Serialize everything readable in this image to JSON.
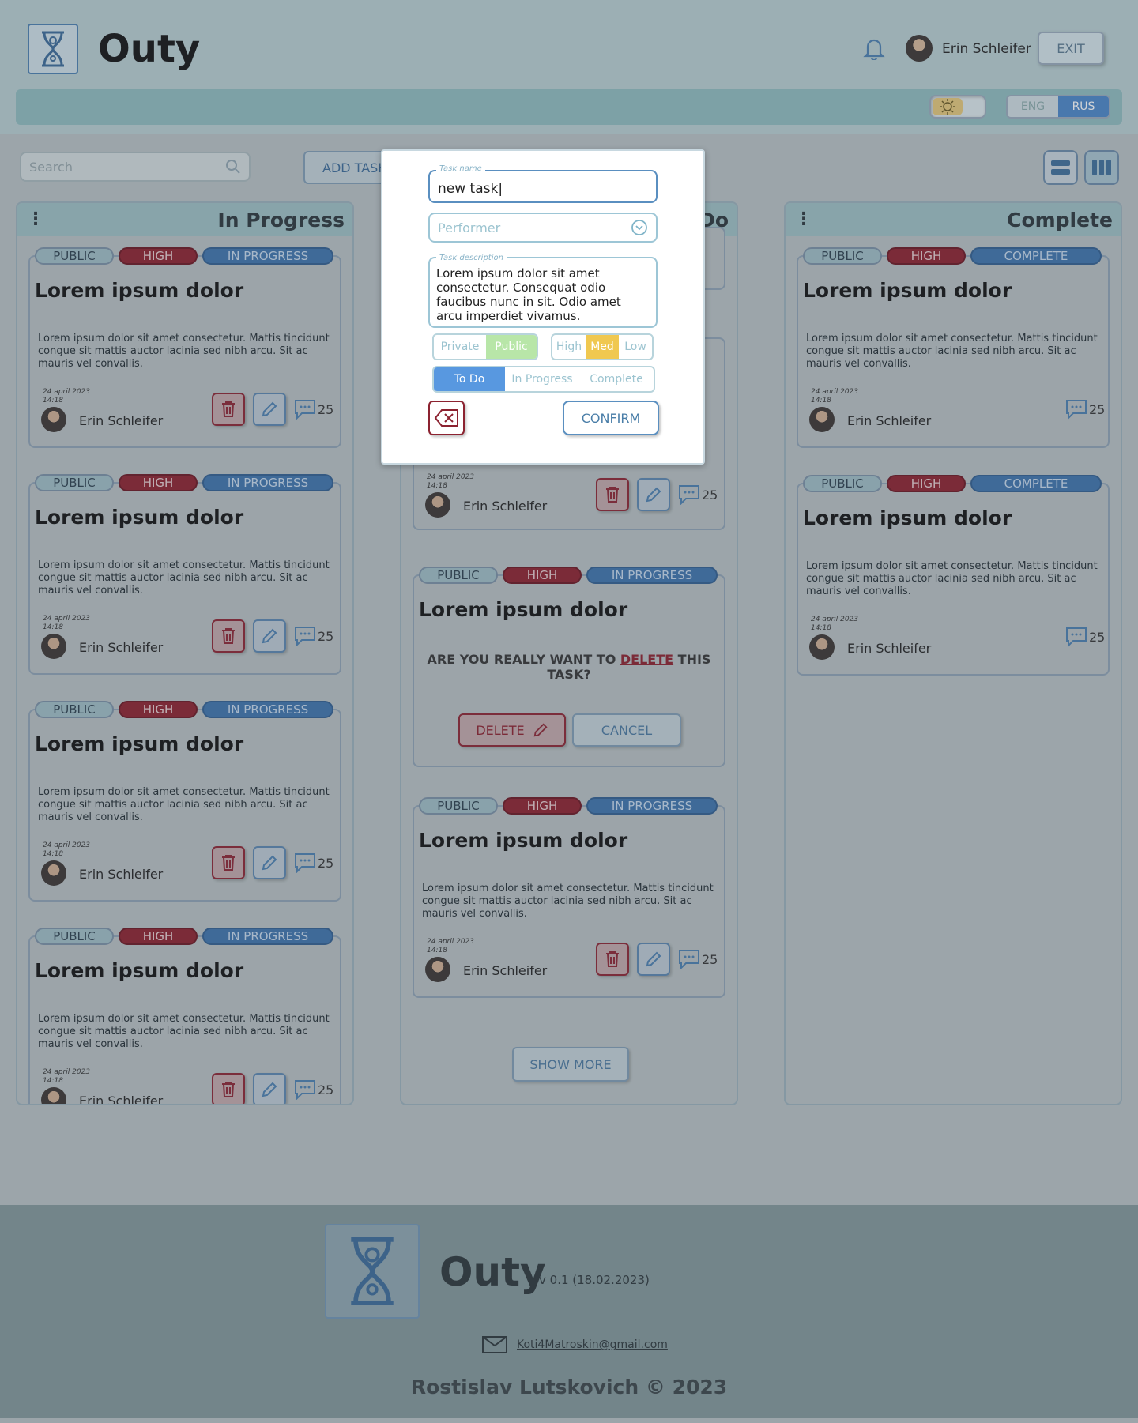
{
  "header": {
    "app_title": "Outy",
    "user_name": "Erin Schleifer",
    "exit_label": "EXIT",
    "lang_eng": "ENG",
    "lang_rus": "RUS"
  },
  "toolbar": {
    "search_placeholder": "Search",
    "add_task_label": "ADD TASK"
  },
  "columns": {
    "in_progress": {
      "title": "In Progress",
      "cards": [
        {
          "visibility": "PUBLIC",
          "priority": "HIGH",
          "status": "IN PROGRESS",
          "title": "Lorem ipsum dolor",
          "text": "Lorem ipsum dolor sit amet consectetur. Mattis tincidunt congue sit mattis auctor lacinia sed nibh arcu. Sit ac mauris vel convallis.",
          "date": "24 april 2023",
          "time": "14:18",
          "user": "Erin Schleifer",
          "comments": "25"
        },
        {
          "visibility": "PUBLIC",
          "priority": "HIGH",
          "status": "IN PROGRESS",
          "title": "Lorem ipsum dolor",
          "text": "Lorem ipsum dolor sit amet consectetur. Mattis tincidunt congue sit mattis auctor lacinia sed nibh arcu. Sit ac mauris vel convallis.",
          "date": "24 april 2023",
          "time": "14:18",
          "user": "Erin Schleifer",
          "comments": "25"
        },
        {
          "visibility": "PUBLIC",
          "priority": "HIGH",
          "status": "IN PROGRESS",
          "title": "Lorem ipsum dolor",
          "text": "Lorem ipsum dolor sit amet consectetur. Mattis tincidunt congue sit mattis auctor lacinia sed nibh arcu. Sit ac mauris vel convallis.",
          "date": "24 april 2023",
          "time": "14:18",
          "user": "Erin Schleifer",
          "comments": "25"
        },
        {
          "visibility": "PUBLIC",
          "priority": "HIGH",
          "status": "IN PROGRESS",
          "title": "Lorem ipsum dolor",
          "text": "Lorem ipsum dolor sit amet consectetur. Mattis tincidunt congue sit mattis auctor lacinia sed nibh arcu. Sit ac mauris vel convallis.",
          "date": "24 april 2023",
          "time": "14:18",
          "user": "Erin Schleifer",
          "comments": "25"
        }
      ]
    },
    "todo": {
      "title": "To Do",
      "card_partial": {
        "date": "24 april 2023",
        "time": "14:18",
        "user": "Erin Schleifer",
        "comments": "25"
      },
      "confirm_card": {
        "visibility": "PUBLIC",
        "priority": "HIGH",
        "status": "IN PROGRESS",
        "title": "Lorem ipsum dolor",
        "question_pre": "ARE YOU REALLY WANT TO ",
        "question_delete": "DELETE",
        "question_post": " THIS TASK?",
        "delete_label": "DELETE",
        "cancel_label": "CANCEL"
      },
      "card_last": {
        "visibility": "PUBLIC",
        "priority": "HIGH",
        "status": "IN PROGRESS",
        "title": "Lorem ipsum dolor",
        "text": "Lorem ipsum dolor sit amet consectetur. Mattis tincidunt congue sit mattis auctor lacinia sed nibh arcu. Sit ac mauris vel convallis.",
        "date": "24 april 2023",
        "time": "14:18",
        "user": "Erin Schleifer",
        "comments": "25"
      },
      "show_more_label": "SHOW MORE"
    },
    "complete": {
      "title": "Complete",
      "cards": [
        {
          "visibility": "PUBLIC",
          "priority": "HIGH",
          "status": "COMPLETE",
          "title": "Lorem ipsum dolor",
          "text": "Lorem ipsum dolor sit amet consectetur. Mattis tincidunt congue sit mattis auctor lacinia sed nibh arcu. Sit ac mauris vel convallis.",
          "date": "24 april 2023",
          "time": "14:18",
          "user": "Erin Schleifer",
          "comments": "25"
        },
        {
          "visibility": "PUBLIC",
          "priority": "HIGH",
          "status": "COMPLETE",
          "title": "Lorem ipsum dolor",
          "text": "Lorem ipsum dolor sit amet consectetur. Mattis tincidunt congue sit mattis auctor lacinia sed nibh arcu. Sit ac mauris vel convallis.",
          "date": "24 april 2023",
          "time": "14:18",
          "user": "Erin Schleifer",
          "comments": "25"
        }
      ]
    }
  },
  "modal": {
    "task_name_label": "Task name",
    "task_name_value": "new task|",
    "performer_placeholder": "Performer",
    "description_label": "Task description",
    "description_value": "Lorem ipsum dolor sit amet consectetur. Consequat odio faucibus nunc in sit. Odio amet arcu imperdiet vivamus.",
    "visibility_options": [
      "Private",
      "Public"
    ],
    "visibility_selected": "Public",
    "priority_options": [
      "High",
      "Med",
      "Low"
    ],
    "priority_selected": "Med",
    "status_options": [
      "To Do",
      "In Progress",
      "Complete"
    ],
    "status_selected": "To Do",
    "confirm_label": "CONFIRM"
  },
  "footer": {
    "title": "Outy",
    "version": "v 0.1 (18.02.2023)",
    "email": "Koti4Matroskin@gmail.com",
    "copyright": "Rostislav Lutskovich © 2023"
  },
  "colors": {
    "accent_blue": "#3d73ad",
    "high_red": "#8c1f2c",
    "header_teal": "#9ec0c4"
  }
}
